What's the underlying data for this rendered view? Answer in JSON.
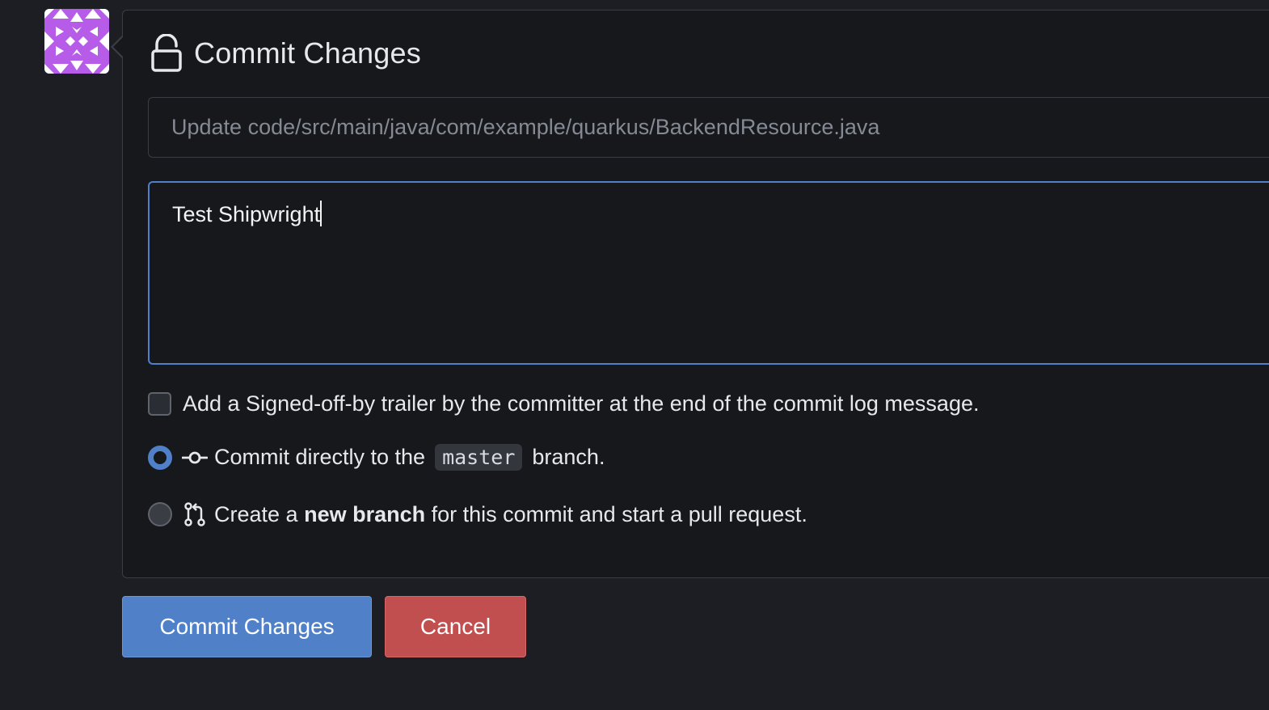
{
  "avatar": {
    "color": "#b65ce8"
  },
  "header": {
    "icon": "unlock-icon",
    "title": "Commit Changes"
  },
  "summary": {
    "placeholder": "Update code/src/main/java/com/example/quarkus/BackendResource.java",
    "value": ""
  },
  "message": {
    "value": "Test Shipwright"
  },
  "signoff": {
    "checked": false,
    "label": "Add a Signed-off-by trailer by the committer at the end of the commit log message."
  },
  "commit_options": {
    "direct": {
      "selected": true,
      "icon": "git-commit-icon",
      "text_before": "Commit directly to the",
      "branch": "master",
      "text_after": "branch."
    },
    "new_branch": {
      "selected": false,
      "icon": "git-pull-request-icon",
      "text_before": "Create a",
      "bold": "new branch",
      "text_after": "for this commit and start a pull request."
    }
  },
  "buttons": {
    "commit_label": "Commit Changes",
    "cancel_label": "Cancel"
  },
  "colors": {
    "primary": "#4f80c8",
    "danger": "#c24f4f",
    "background": "#1c1e23",
    "panel": "#16181c"
  }
}
